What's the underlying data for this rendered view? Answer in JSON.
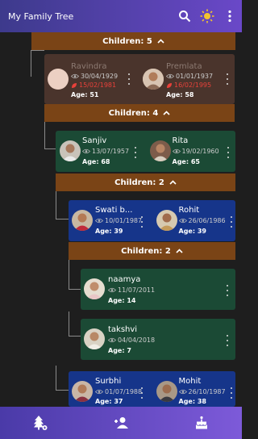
{
  "app": {
    "title": "My Family Tree"
  },
  "toolbar": {
    "search_icon": "search-icon",
    "theme_icon": "brightness-icon",
    "menu_icon": "more-vert-icon"
  },
  "top_bar": {
    "label": "Children: 5"
  },
  "couple1": {
    "left": {
      "name": "Ravindra",
      "date": "30/04/1929",
      "death": "15/02/1981",
      "age": "Age: 51"
    },
    "right": {
      "name": "Premlata",
      "date": "01/01/1937",
      "death": "16/02/1995",
      "age": "Age: 58"
    },
    "children": "Children: 4"
  },
  "couple2": {
    "left": {
      "name": "Sanjiv",
      "date": "13/07/1957",
      "age": "Age: 68"
    },
    "right": {
      "name": "Rita",
      "date": "19/02/1960",
      "age": "Age: 65"
    },
    "children": "Children: 2"
  },
  "couple3": {
    "left": {
      "name": "Swati b...",
      "date": "10/01/1987",
      "age": "Age: 39"
    },
    "right": {
      "name": "Rohit",
      "date": "26/06/1986",
      "age": "Age: 39"
    },
    "children": "Children: 2"
  },
  "child1": {
    "name": "naamya",
    "date": "11/07/2011",
    "age": "Age: 14"
  },
  "child2": {
    "name": "takshvi",
    "date": "04/04/2018",
    "age": "Age: 7"
  },
  "couple4": {
    "left": {
      "name": "Surbhi",
      "date": "01/07/1988",
      "age": "Age: 37"
    },
    "right": {
      "name": "Mohit",
      "date": "26/10/1987",
      "age": "Age: 38"
    }
  },
  "nav": {
    "tree_icon": "family-tree-icon",
    "add_person_icon": "person-add-icon",
    "cake_icon": "birthday-cake-icon"
  },
  "colors": {
    "appbar_start": "#3d3a8c",
    "appbar_end": "#6a48c8",
    "children_bar": "#7a4416",
    "deceased_card": "#4a342c",
    "green_card": "#1b4a35",
    "blue_card": "#16358a",
    "death_red": "#e8413a"
  }
}
